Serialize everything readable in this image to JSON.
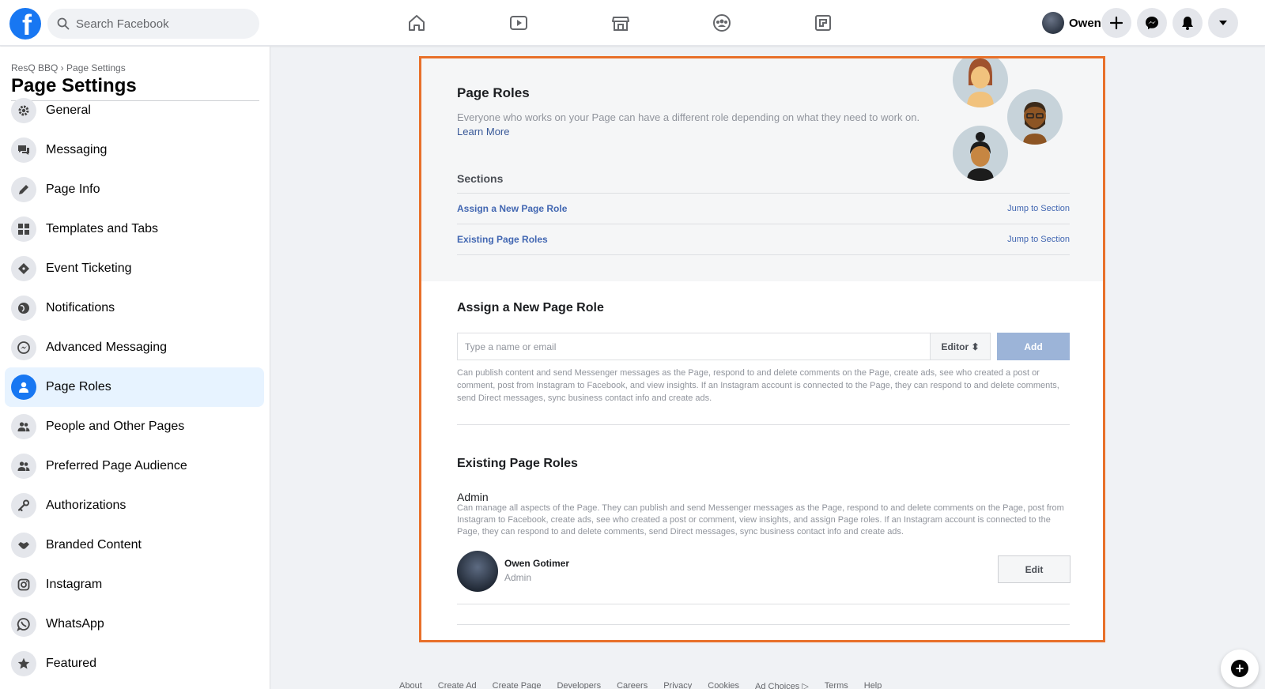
{
  "topbar": {
    "logo_letter": "f",
    "search_placeholder": "Search Facebook",
    "nav_icons": [
      "home-icon",
      "watch-icon",
      "marketplace-icon",
      "groups-icon",
      "gaming-icon"
    ],
    "profile_name": "Owen",
    "action_icons": [
      "create-icon",
      "messenger-icon",
      "notifications-icon",
      "account-menu-icon"
    ]
  },
  "sidebar": {
    "breadcrumb": "ResQ BBQ › Page Settings",
    "title": "Page Settings",
    "items": [
      {
        "label": "General",
        "icon": "gear-icon"
      },
      {
        "label": "Messaging",
        "icon": "messaging-icon"
      },
      {
        "label": "Page Info",
        "icon": "pencil-icon"
      },
      {
        "label": "Templates and Tabs",
        "icon": "grid-icon"
      },
      {
        "label": "Event Ticketing",
        "icon": "ticket-icon"
      },
      {
        "label": "Notifications",
        "icon": "globe-icon"
      },
      {
        "label": "Advanced Messaging",
        "icon": "messenger-icon"
      },
      {
        "label": "Page Roles",
        "icon": "person-icon",
        "active": true
      },
      {
        "label": "People and Other Pages",
        "icon": "people-icon"
      },
      {
        "label": "Preferred Page Audience",
        "icon": "audience-icon"
      },
      {
        "label": "Authorizations",
        "icon": "key-icon"
      },
      {
        "label": "Branded Content",
        "icon": "handshake-icon"
      },
      {
        "label": "Instagram",
        "icon": "instagram-icon"
      },
      {
        "label": "WhatsApp",
        "icon": "whatsapp-icon"
      },
      {
        "label": "Featured",
        "icon": "star-icon"
      }
    ]
  },
  "roles": {
    "title": "Page Roles",
    "description": "Everyone who works on your Page can have a different role depending on what they need to work on.",
    "learn_more": "Learn More",
    "sections_label": "Sections",
    "sections": [
      {
        "name": "Assign a New Page Role",
        "jump": "Jump to Section"
      },
      {
        "name": "Existing Page Roles",
        "jump": "Jump to Section"
      }
    ]
  },
  "assign": {
    "title": "Assign a New Page Role",
    "input_placeholder": "Type a name or email",
    "role_selected": "Editor ⬍",
    "add_label": "Add",
    "description": "Can publish content and send Messenger messages as the Page, respond to and delete comments on the Page, create ads, see who created a post or comment, post from Instagram to Facebook, and view insights. If an Instagram account is connected to the Page, they can respond to and delete comments, send Direct messages, sync business contact info and create ads."
  },
  "existing": {
    "title": "Existing Page Roles",
    "admin_title": "Admin",
    "admin_description": "Can manage all aspects of the Page. They can publish and send Messenger messages as the Page, respond to and delete comments on the Page, post from Instagram to Facebook, create ads, see who created a post or comment, view insights, and assign Page roles. If an Instagram account is connected to the Page, they can respond to and delete comments, send Direct messages, sync business contact info and create ads.",
    "user_name": "Owen Gotimer",
    "user_role": "Admin",
    "edit_label": "Edit"
  },
  "footer": {
    "links": [
      "About",
      "Create Ad",
      "Create Page",
      "Developers",
      "Careers",
      "Privacy",
      "Cookies",
      "Ad Choices ▷",
      "Terms",
      "Help"
    ]
  },
  "colors": {
    "brand": "#1877f2",
    "highlight_border": "#e8702a",
    "link": "#4267b2",
    "add_button": "#9cb4d8",
    "active_item_bg": "#e7f3ff"
  }
}
